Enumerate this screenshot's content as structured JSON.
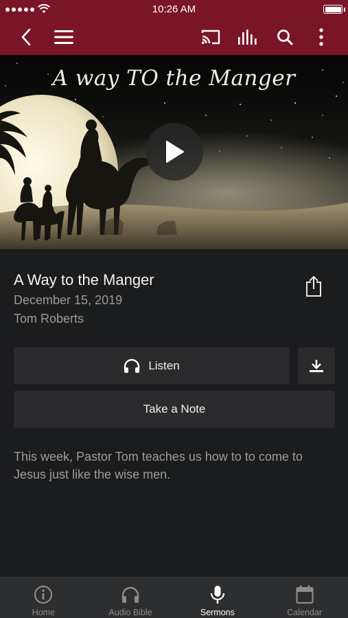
{
  "status_bar": {
    "time": "10:26 AM"
  },
  "hero": {
    "overlay_title": "A way TO the Manger"
  },
  "sermon": {
    "title": "A Way to the Manger",
    "date": "December 15, 2019",
    "speaker": "Tom Roberts",
    "description": "This week, Pastor Tom teaches us how to to come to Jesus just like the wise men."
  },
  "actions": {
    "listen_label": "Listen",
    "note_label": "Take a Note"
  },
  "tabs": [
    {
      "label": "Home",
      "icon": "info-icon"
    },
    {
      "label": "Audio Bible",
      "icon": "headphones-icon"
    },
    {
      "label": "Sermons",
      "icon": "microphone-icon",
      "active": true
    },
    {
      "label": "Calendar",
      "icon": "calendar-icon"
    }
  ],
  "colors": {
    "brand": "#7a1528",
    "background": "#1b1c1e",
    "button": "#2b2b2d",
    "tab_bar": "#2d2e30"
  }
}
